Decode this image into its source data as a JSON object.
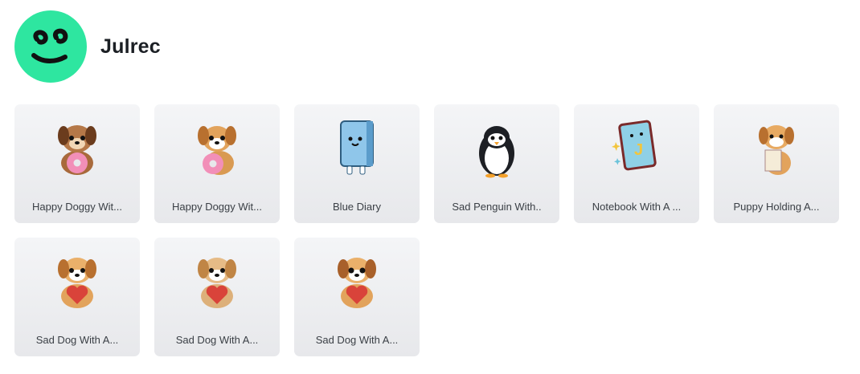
{
  "profile": {
    "username": "Julrec",
    "avatar_color": "#2ee6a0",
    "avatar_icon": "smiley-face-icon"
  },
  "stickers": [
    {
      "label": "Happy Doggy Wit...",
      "icon": "dog-donut"
    },
    {
      "label": "Happy Doggy Wit...",
      "icon": "dog-donut"
    },
    {
      "label": "Blue Diary",
      "icon": "blue-diary"
    },
    {
      "label": "Sad Penguin With..",
      "icon": "penguin"
    },
    {
      "label": "Notebook With A ...",
      "icon": "notebook-j"
    },
    {
      "label": "Puppy Holding A...",
      "icon": "dog-paper"
    },
    {
      "label": "Sad Dog With A...",
      "icon": "dog-heart"
    },
    {
      "label": "Sad Dog With A...",
      "icon": "dog-heart"
    },
    {
      "label": "Sad Dog With A...",
      "icon": "dog-heart"
    }
  ]
}
